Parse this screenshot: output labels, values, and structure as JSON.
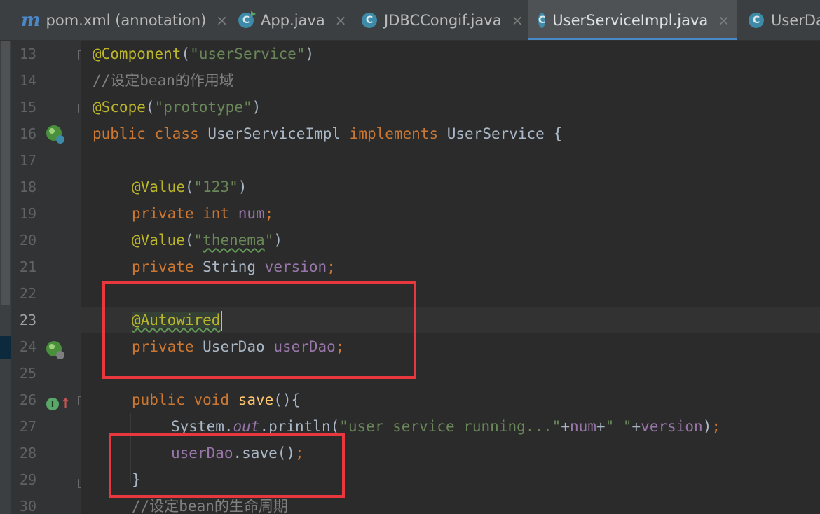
{
  "tabs": [
    {
      "label": "pom.xml (annotation)",
      "icon": "maven-icon",
      "icon_text": "m",
      "closable": true,
      "active": false
    },
    {
      "label": "App.java",
      "icon": "java-class-runnable-icon",
      "icon_text": "C",
      "closable": true,
      "active": false
    },
    {
      "label": "JDBCCongif.java",
      "icon": "java-class-icon",
      "icon_text": "C",
      "closable": true,
      "active": false
    },
    {
      "label": "UserServiceImpl.java",
      "icon": "java-class-icon",
      "icon_text": "C",
      "closable": true,
      "active": true
    },
    {
      "label": "UserDa",
      "icon": "java-class-icon",
      "icon_text": "C",
      "closable": false,
      "active": false
    }
  ],
  "close_glyph": "×",
  "line_numbers": [
    "13",
    "14",
    "15",
    "16",
    "17",
    "18",
    "19",
    "20",
    "21",
    "22",
    "23",
    "24",
    "25",
    "26",
    "27",
    "28",
    "29",
    "30"
  ],
  "current_line": "23",
  "code": {
    "l13": {
      "anno": "@Component",
      "p1": "(",
      "str": "\"userService\"",
      "p2": ")"
    },
    "l14": {
      "comment": "//设定bean的作用域"
    },
    "l15": {
      "anno": "@Scope",
      "p1": "(",
      "str": "\"prototype\"",
      "p2": ")"
    },
    "l16": {
      "kw1": "public class ",
      "name": "UserServiceImpl ",
      "kw2": "implements ",
      "iface": "UserService {"
    },
    "l18": {
      "anno": "@Value",
      "p1": "(",
      "str": "\"123\"",
      "p2": ")"
    },
    "l19": {
      "kw": "private int ",
      "field": "num",
      "semi": ";"
    },
    "l20": {
      "anno": "@Value",
      "p1": "(",
      "q1": "\"",
      "str": "thenema",
      "q2": "\"",
      "p2": ")"
    },
    "l21": {
      "kw": "private ",
      "type": "String ",
      "field": "version",
      "semi": ";"
    },
    "l23": {
      "anno": "@Autowired"
    },
    "l24": {
      "kw": "private ",
      "type": "UserDao ",
      "field": "userDao",
      "semi": ";"
    },
    "l26": {
      "kw": "public void ",
      "method": "save",
      "rest": "(){"
    },
    "l27": {
      "sys": "System.",
      "out": "out",
      "dot": ".println(",
      "str1": "\"user service running...\"",
      "plus1": "+",
      "f1": "num",
      "plus2": "+",
      "str2": "\" \"",
      "plus3": "+",
      "f2": "version",
      "close": ")",
      "semi": ";"
    },
    "l28": {
      "field": "userDao",
      "call": ".save()",
      "semi": ";"
    },
    "l29": {
      "brace": "}"
    },
    "l30": {
      "comment": "//设定bean的生命周期"
    }
  },
  "colors": {
    "annotation": "#bbb529",
    "string": "#6a8759",
    "keyword": "#cc7832",
    "comment": "#808080",
    "field": "#9876aa",
    "method": "#ffc66d",
    "text": "#a9b7c6",
    "highlight_box": "#e8383d"
  },
  "gutter_icons": {
    "l16": "spring-bean-icon",
    "l24": "spring-autowired-icon",
    "l26": "implements-method-icon"
  }
}
